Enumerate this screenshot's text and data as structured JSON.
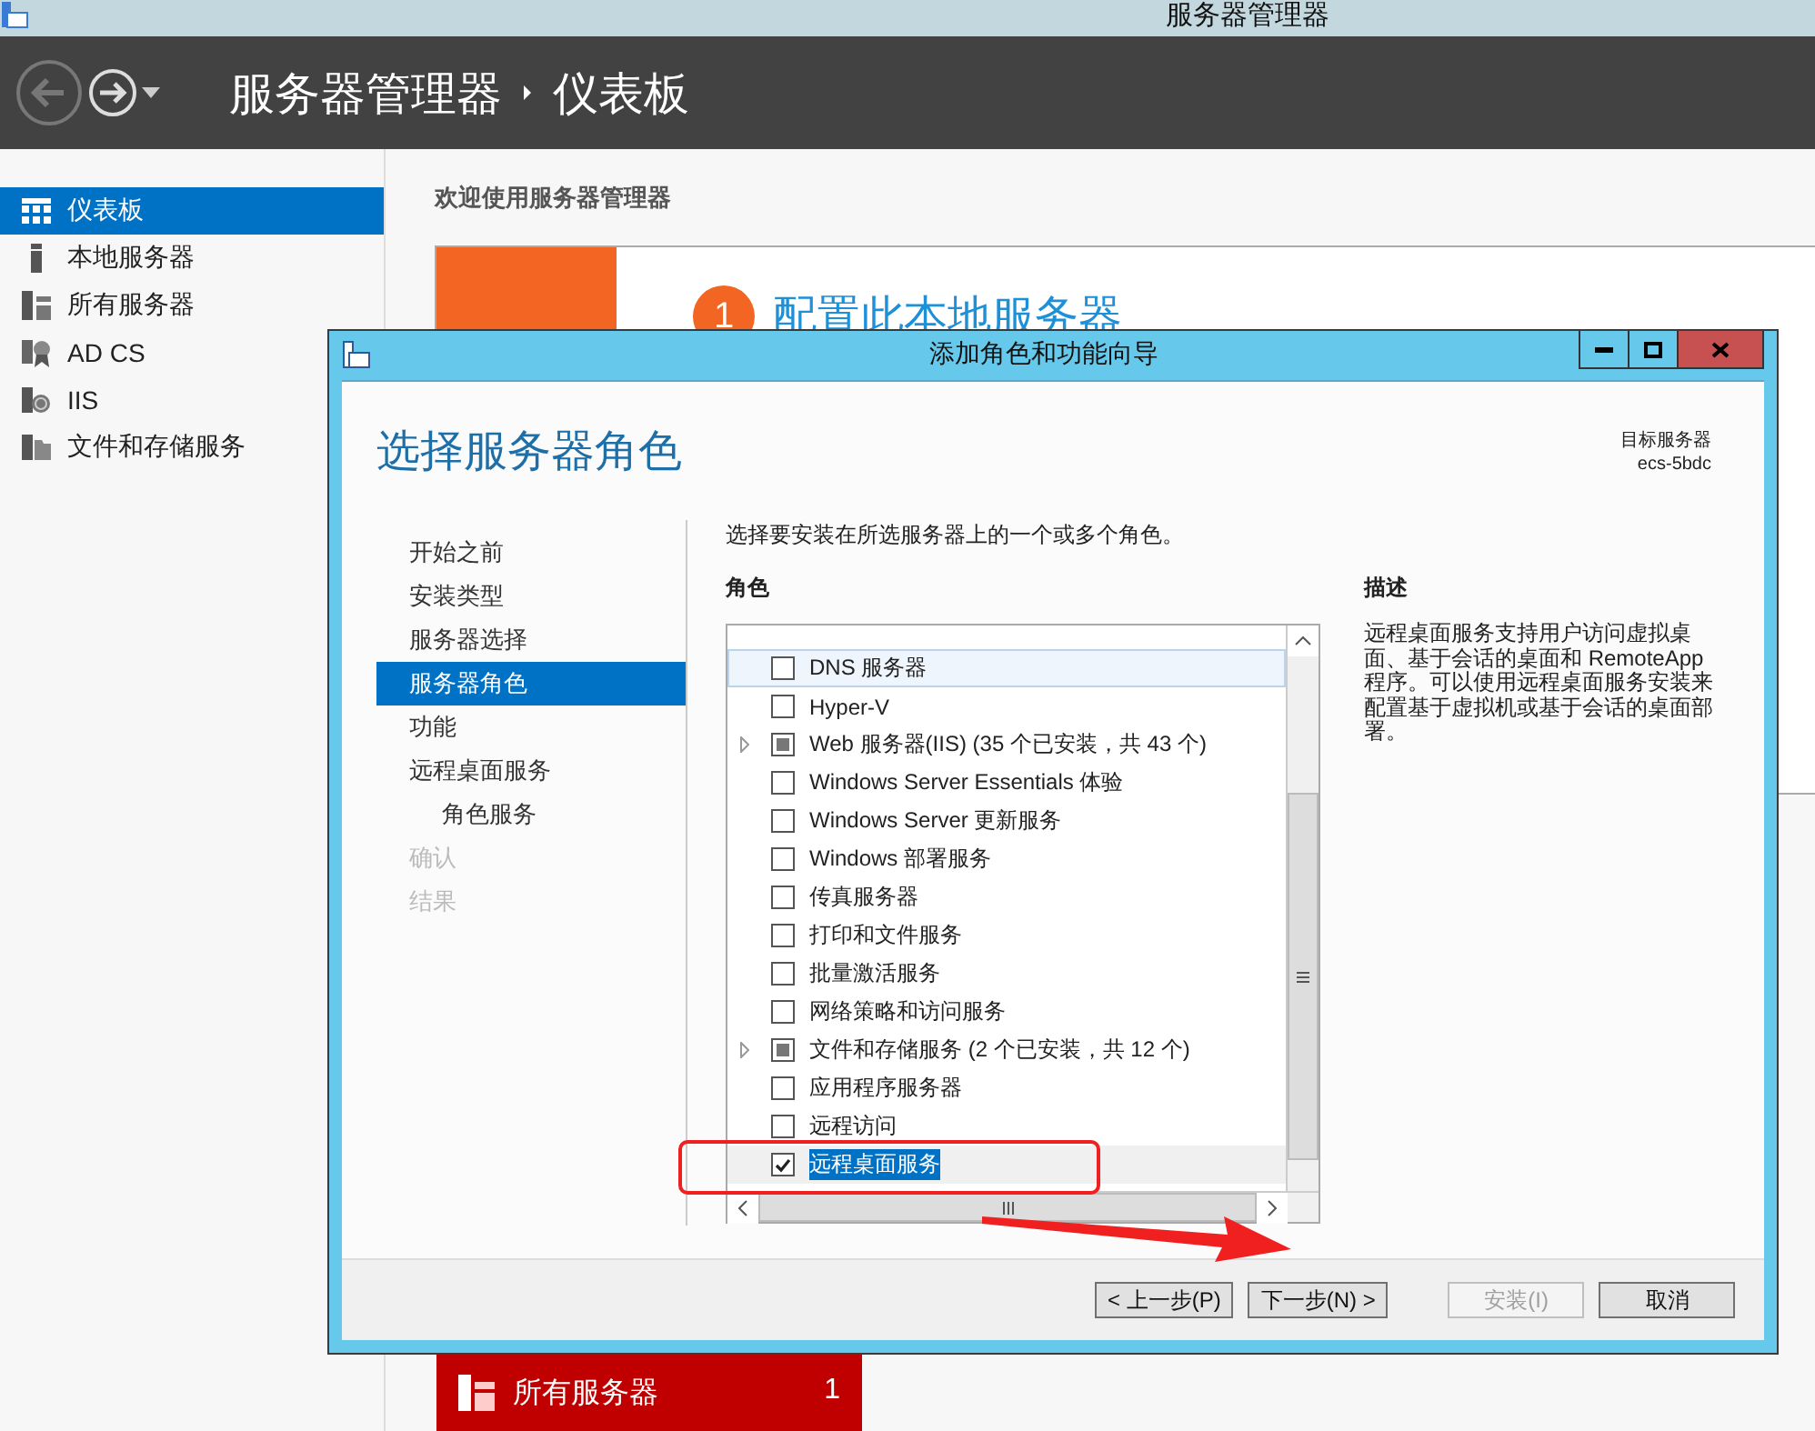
{
  "app_title": "服务器管理器",
  "header": {
    "breadcrumb": [
      "服务器管理器",
      "仪表板"
    ]
  },
  "sidebar": {
    "items": [
      {
        "label": "仪表板",
        "selected": true
      },
      {
        "label": "本地服务器",
        "selected": false
      },
      {
        "label": "所有服务器",
        "selected": false
      },
      {
        "label": "AD CS",
        "selected": false
      },
      {
        "label": "IIS",
        "selected": false
      },
      {
        "label": "文件和存储服务",
        "selected": false
      }
    ]
  },
  "welcome": {
    "title": "欢迎使用服务器管理器",
    "step_number": "1",
    "step_title": "配置此本地服务器"
  },
  "tile": {
    "label": "所有服务器",
    "count": "1"
  },
  "dialog": {
    "title": "添加角色和功能向导",
    "heading": "选择服务器角色",
    "target_label": "目标服务器",
    "target_server": "ecs-5bdc",
    "steps": [
      {
        "label": "开始之前",
        "selected": false,
        "disabled": false
      },
      {
        "label": "安装类型",
        "selected": false,
        "disabled": false
      },
      {
        "label": "服务器选择",
        "selected": false,
        "disabled": false
      },
      {
        "label": "服务器角色",
        "selected": true,
        "disabled": false
      },
      {
        "label": "功能",
        "selected": false,
        "disabled": false
      },
      {
        "label": "远程桌面服务",
        "selected": false,
        "disabled": false,
        "children": [
          {
            "label": "角色服务",
            "selected": false,
            "disabled": false
          }
        ]
      },
      {
        "label": "确认",
        "selected": false,
        "disabled": true
      },
      {
        "label": "结果",
        "selected": false,
        "disabled": true
      }
    ],
    "instruction": "选择要安装在所选服务器上的一个或多个角色。",
    "roles_label": "角色",
    "roles": [
      {
        "label": "DNS 服务器",
        "checked": false,
        "indeterminate": false,
        "expandable": false,
        "hovered": true,
        "selected": false
      },
      {
        "label": "Hyper-V",
        "checked": false,
        "indeterminate": false,
        "expandable": false,
        "hovered": false,
        "selected": false
      },
      {
        "label": "Web 服务器(IIS) (35 个已安装，共 43 个)",
        "checked": false,
        "indeterminate": true,
        "expandable": true,
        "hovered": false,
        "selected": false
      },
      {
        "label": "Windows Server Essentials 体验",
        "checked": false,
        "indeterminate": false,
        "expandable": false,
        "hovered": false,
        "selected": false
      },
      {
        "label": "Windows Server 更新服务",
        "checked": false,
        "indeterminate": false,
        "expandable": false,
        "hovered": false,
        "selected": false
      },
      {
        "label": "Windows 部署服务",
        "checked": false,
        "indeterminate": false,
        "expandable": false,
        "hovered": false,
        "selected": false
      },
      {
        "label": "传真服务器",
        "checked": false,
        "indeterminate": false,
        "expandable": false,
        "hovered": false,
        "selected": false
      },
      {
        "label": "打印和文件服务",
        "checked": false,
        "indeterminate": false,
        "expandable": false,
        "hovered": false,
        "selected": false
      },
      {
        "label": "批量激活服务",
        "checked": false,
        "indeterminate": false,
        "expandable": false,
        "hovered": false,
        "selected": false
      },
      {
        "label": "网络策略和访问服务",
        "checked": false,
        "indeterminate": false,
        "expandable": false,
        "hovered": false,
        "selected": false
      },
      {
        "label": "文件和存储服务 (2 个已安装，共 12 个)",
        "checked": false,
        "indeterminate": true,
        "expandable": true,
        "hovered": false,
        "selected": false
      },
      {
        "label": "应用程序服务器",
        "checked": false,
        "indeterminate": false,
        "expandable": false,
        "hovered": false,
        "selected": false
      },
      {
        "label": "远程访问",
        "checked": false,
        "indeterminate": false,
        "expandable": false,
        "hovered": false,
        "selected": false
      },
      {
        "label": "远程桌面服务",
        "checked": true,
        "indeterminate": false,
        "expandable": false,
        "hovered": false,
        "selected": true
      }
    ],
    "description_label": "描述",
    "description": "远程桌面服务支持用户访问虚拟桌面、基于会话的桌面和 RemoteApp 程序。可以使用远程桌面服务安装来配置基于虚拟机或基于会话的桌面部署。",
    "buttons": [
      {
        "label": "< 上一步(P)",
        "disabled": false
      },
      {
        "label": "下一步(N) >",
        "disabled": false
      },
      {
        "label": "安装(I)",
        "disabled": true
      },
      {
        "label": "取消",
        "disabled": false
      }
    ]
  }
}
